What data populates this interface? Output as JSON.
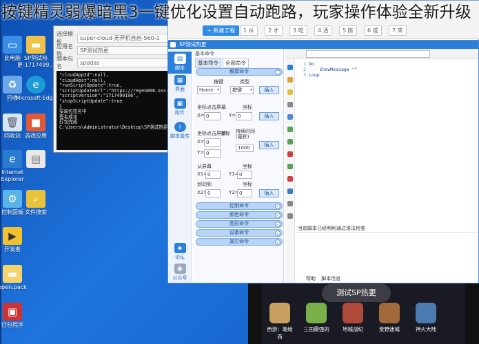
{
  "overlay_caption": "按键精灵弱爆暗黑3一键优化设置自动跑路，玩家操作体验全新升级",
  "desktop_icons": [
    {
      "label": "此电脑",
      "icon": "computer-icon",
      "color": "#3a8ee6"
    },
    {
      "label": "SP测试热更-1717499...",
      "icon": "folder-icon",
      "color": "#f0c24a"
    },
    {
      "label": "回收",
      "icon": "recycle-icon",
      "color": "#6aa6e8"
    },
    {
      "label": "Microsoft Edge",
      "icon": "edge-icon",
      "color": "#1c9ad6"
    },
    {
      "label": "回收站",
      "icon": "trash-icon",
      "color": "#d7e6f5"
    },
    {
      "label": "游戏应用",
      "icon": "app-icon",
      "color": "#e05a3a"
    },
    {
      "label": "Internet Explorer",
      "icon": "ie-icon",
      "color": "#2a7ad0"
    },
    {
      "label": "",
      "icon": "file-icon",
      "color": "#e9e9e9"
    },
    {
      "label": "控制面板",
      "icon": "control-panel-icon",
      "color": "#5ab4e8"
    },
    {
      "label": "文件搜索",
      "icon": "search-file-icon",
      "color": "#e8c23a"
    },
    {
      "label": "开发者",
      "icon": "devtool-icon",
      "color": "#f2c12e"
    },
    {
      "label": "open.pack",
      "icon": "pack-icon",
      "color": "#f4d36a"
    },
    {
      "label": "打包程序",
      "icon": "packager-icon",
      "color": "#c33"
    }
  ],
  "console_window": {
    "rows": [
      {
        "label": "选择模板",
        "value": "super-cloud-无开机自启-560-1"
      },
      {
        "label": "应用名称",
        "value": "SP测试热更"
      },
      {
        "label": "脚本包名",
        "value": "spddas"
      }
    ],
    "lines": [
      "\"cloudAppId\":null,",
      "\"cloudHost\":null,",
      "\"runScriptUpdate\":true,",
      "\"scriptUpdateUrl\":\"https://regen008.oss-cn-h",
      "\"scriptVersion\":\"1717499196\",",
      "\"stopScriptUpdate\":true",
      "}",
      "安装包签名中",
      "签名成功",
      "打包完成",
      "C:\\Users\\Administrator\\Desktop\\SP测试热更-1717..."
    ]
  },
  "app_top": {
    "new_project": "+ 新建工程",
    "levels": [
      "1 从",
      "2 才",
      "3 吃",
      "4 活",
      "5 陈",
      "6 成",
      "7 宋"
    ]
  },
  "sp_window": {
    "title": "SP测试热更",
    "nav": [
      {
        "label": "脚本",
        "icon": "script-icon"
      },
      {
        "label": "界面",
        "icon": "ui-icon"
      },
      {
        "label": "附件",
        "icon": "attachment-icon"
      },
      {
        "label": "脚本属性",
        "icon": "info-icon"
      },
      {
        "label": "论坛",
        "icon": "forum-icon"
      },
      {
        "label": "公众号",
        "icon": "wechat-icon"
      }
    ],
    "panel_header": "基本命令",
    "tabs": [
      "基本命令",
      "全部命令"
    ],
    "group_touch": "触摸命令",
    "key_label": "按键",
    "type_label": "类型",
    "key_value": "Home",
    "type_value": "按键",
    "insert": "插入",
    "tap_title": "坐标点击屏幕",
    "coord": "坐标",
    "x_label": "X=",
    "y_label": "Y=",
    "zero": "0",
    "press_title": "坐标点击屏幕",
    "press_coord": "坐标",
    "hold_label": "持续时间\n(毫秒)",
    "hold_value": "1000",
    "swipe_title": "从屏幕",
    "swipe_coord": "坐标",
    "x1": "X1=",
    "y1": "Y1=",
    "to_label": "划动到",
    "x2": "X2=",
    "y2": "Y2=",
    "groups": [
      "控制命令",
      "颜色命令",
      "图形命令",
      "设备命令",
      "其它命令"
    ],
    "code_lines": [
      {
        "n": "1",
        "t": "Do"
      },
      {
        "n": "2",
        "t": "    ShowMessage \"\""
      },
      {
        "n": "3",
        "t": "Loop"
      }
    ],
    "status_message": "当前脚本已经明利通过语法检查",
    "bottom_tabs": [
      "帮助",
      "脚本信息"
    ]
  },
  "phone": {
    "title": "测试SP热更",
    "games": [
      {
        "name": "西游：笔绘西",
        "color": "#c8a060"
      },
      {
        "name": "三国最强的",
        "color": "#7ab04a"
      },
      {
        "name": "地城战纪",
        "color": "#b04a3a"
      },
      {
        "name": "荒野迷城",
        "color": "#a06a3a"
      },
      {
        "name": "神火大陆",
        "color": "#4a7ab0"
      }
    ]
  }
}
